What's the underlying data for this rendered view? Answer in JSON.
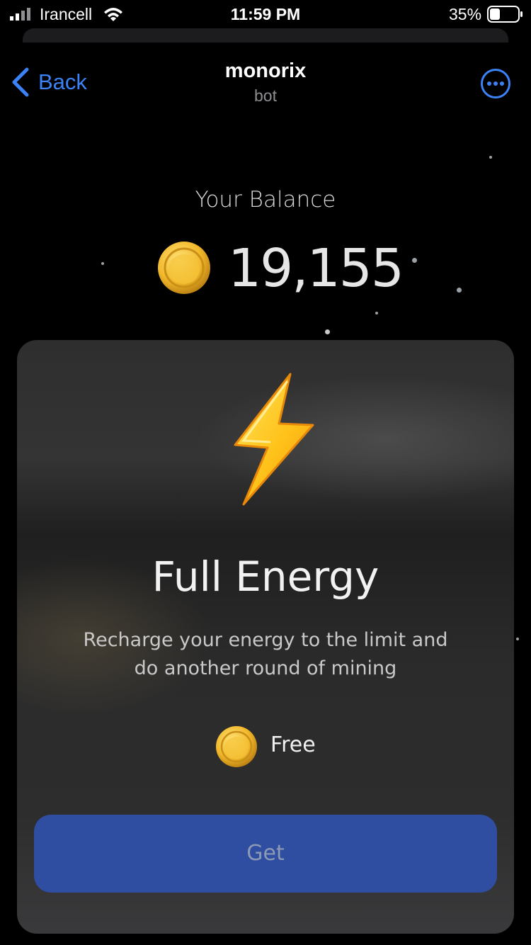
{
  "status_bar": {
    "carrier": "Irancell",
    "time": "11:59 PM",
    "battery_percent": "35%"
  },
  "nav": {
    "back_label": "Back",
    "title": "monorix",
    "subtitle": "bot"
  },
  "balance": {
    "label": "Your Balance",
    "value": "19,155"
  },
  "card": {
    "title": "Full Energy",
    "description": "Recharge your energy to the limit and do another round of mining",
    "price_label": "Free",
    "button_label": "Get"
  },
  "colors": {
    "accent": "#3b82f6",
    "button_bg": "#2f4ea1",
    "coin": "#f2b92b"
  }
}
